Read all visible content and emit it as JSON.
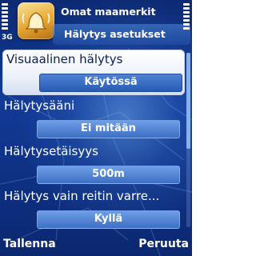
{
  "header": {
    "app_title": "Omat maamerkit",
    "subtitle": "Hälytys asetukset",
    "network": "3G",
    "app_icon": "alarm-bell-icon"
  },
  "settings": [
    {
      "label": "Visuaalinen hälytys",
      "value": "Käytössä"
    },
    {
      "label": "Hälytysääni",
      "value": "Ei mitään"
    },
    {
      "label": "Hälytysetäisyys",
      "value": "500m"
    },
    {
      "label": "Hälytys vain reitin varre...",
      "value": "Kyllä"
    }
  ],
  "softkeys": {
    "left": "Tallenna",
    "right": "Peruuta"
  },
  "colors": {
    "background": "#123a96",
    "highlight": "#ffffff",
    "value_box": "#3d6fc3"
  }
}
